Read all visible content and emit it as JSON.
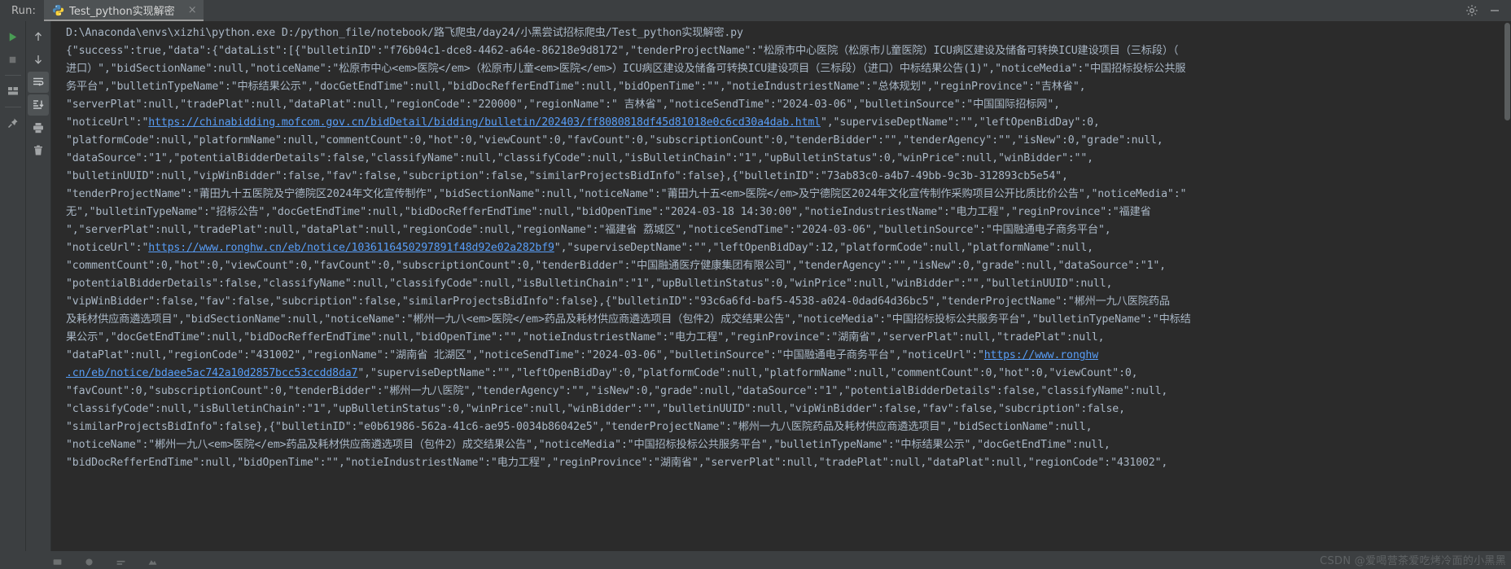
{
  "window": {
    "run_label": "Run:",
    "tab_title": "Test_python实现解密",
    "tab_close_glyph": "×"
  },
  "titlebar_actions": [
    {
      "name": "settings-icon",
      "label": "Settings"
    },
    {
      "name": "hide-icon",
      "label": "Hide"
    }
  ],
  "toolbar_primary": [
    {
      "name": "rerun-button",
      "label": "Rerun"
    },
    {
      "name": "stop-button",
      "label": "Stop"
    },
    {
      "name": "layout-button",
      "label": "Layout Settings"
    },
    {
      "name": "pin-button",
      "label": "Pin Tab"
    }
  ],
  "toolbar_secondary": [
    {
      "name": "up-stack-trace-button",
      "label": "Up the Stack Trace"
    },
    {
      "name": "down-stack-trace-button",
      "label": "Down the Stack Trace"
    },
    {
      "name": "soft-wrap-button",
      "label": "Soft-Wrap"
    },
    {
      "name": "scroll-to-end-button",
      "label": "Scroll to the End"
    },
    {
      "name": "print-button",
      "label": "Print"
    },
    {
      "name": "clear-all-button",
      "label": "Clear All"
    }
  ],
  "console": {
    "command": "D:\\Anaconda\\envs\\xizhi\\python.exe D:/python_file/notebook/路飞爬虫/day24/小黑尝试招标爬虫/Test_python实现解密.py",
    "lines": [
      [
        {
          "t": "{\"success\":true,\"data\":{\"dataList\":[{\"bulletinID\":\"f76b04c1-dce8-4462-a64e-86218e9d8172\",\"tenderProjectName\":\"松原市中心医院（松原市儿童医院）ICU病区建设及储备可转换ICU建设项目（三标段）（"
        }
      ],
      [
        {
          "t": "进口）\",\"bidSectionName\":null,\"noticeName\":\"松原市中心<em>医院</em>（松原市儿童<em>医院</em>）ICU病区建设及储备可转换ICU建设项目（三标段）（进口）中标结果公告(1)\",\"noticeMedia\":\"中国招标投标公共服"
        }
      ],
      [
        {
          "t": "务平台\",\"bulletinTypeName\":\"中标结果公示\",\"docGetEndTime\":null,\"bidDocRefferEndTime\":null,\"bidOpenTime\":\"\",\"notieIndustriestName\":\"总体规划\",\"reginProvince\":\"吉林省\","
        }
      ],
      [
        {
          "t": "\"serverPlat\":null,\"tradePlat\":null,\"dataPlat\":null,\"regionCode\":\"220000\",\"regionName\":\" 吉林省\",\"noticeSendTime\":\"2024-03-06\",\"bulletinSource\":\"中国国际招标网\","
        }
      ],
      [
        {
          "t": "\"noticeUrl\":\""
        },
        {
          "t": "https://chinabidding.mofcom.gov.cn/bidDetail/bidding/bulletin/202403/ff8080818df45d81018e0c6cd30a4dab.html",
          "link": true
        },
        {
          "t": "\",\"superviseDeptName\":\"\",\"leftOpenBidDay\":0,"
        }
      ],
      [
        {
          "t": "\"platformCode\":null,\"platformName\":null,\"commentCount\":0,\"hot\":0,\"viewCount\":0,\"favCount\":0,\"subscriptionCount\":0,\"tenderBidder\":\"\",\"tenderAgency\":\"\",\"isNew\":0,\"grade\":null,"
        }
      ],
      [
        {
          "t": "\"dataSource\":\"1\",\"potentialBidderDetails\":false,\"classifyName\":null,\"classifyCode\":null,\"isBulletinChain\":\"1\",\"upBulletinStatus\":0,\"winPrice\":null,\"winBidder\":\"\","
        }
      ],
      [
        {
          "t": "\"bulletinUUID\":null,\"vipWinBidder\":false,\"fav\":false,\"subcription\":false,\"similarProjectsBidInfo\":false},{\"bulletinID\":\"73ab83c0-a4b7-49bb-9c3b-312893cb5e54\","
        }
      ],
      [
        {
          "t": "\"tenderProjectName\":\"莆田九十五医院及宁德院区2024年文化宣传制作\",\"bidSectionName\":null,\"noticeName\":\"莆田九十五<em>医院</em>及宁德院区2024年文化宣传制作采购项目公开比质比价公告\",\"noticeMedia\":\""
        }
      ],
      [
        {
          "t": "无\",\"bulletinTypeName\":\"招标公告\",\"docGetEndTime\":null,\"bidDocRefferEndTime\":null,\"bidOpenTime\":\"2024-03-18 14:30:00\",\"notieIndustriestName\":\"电力工程\",\"reginProvince\":\"福建省"
        }
      ],
      [
        {
          "t": "\",\"serverPlat\":null,\"tradePlat\":null,\"dataPlat\":null,\"regionCode\":null,\"regionName\":\"福建省 荔城区\",\"noticeSendTime\":\"2024-03-06\",\"bulletinSource\":\"中国融通电子商务平台\","
        }
      ],
      [
        {
          "t": "\"noticeUrl\":\""
        },
        {
          "t": "https://www.ronghw.cn/eb/notice/1036116450297891f48d92e02a282bf9",
          "link": true
        },
        {
          "t": "\",\"superviseDeptName\":\"\",\"leftOpenBidDay\":12,\"platformCode\":null,\"platformName\":null,"
        }
      ],
      [
        {
          "t": "\"commentCount\":0,\"hot\":0,\"viewCount\":0,\"favCount\":0,\"subscriptionCount\":0,\"tenderBidder\":\"中国融通医疗健康集团有限公司\",\"tenderAgency\":\"\",\"isNew\":0,\"grade\":null,\"dataSource\":\"1\","
        }
      ],
      [
        {
          "t": "\"potentialBidderDetails\":false,\"classifyName\":null,\"classifyCode\":null,\"isBulletinChain\":\"1\",\"upBulletinStatus\":0,\"winPrice\":null,\"winBidder\":\"\",\"bulletinUUID\":null,"
        }
      ],
      [
        {
          "t": "\"vipWinBidder\":false,\"fav\":false,\"subcription\":false,\"similarProjectsBidInfo\":false},{\"bulletinID\":\"93c6a6fd-baf5-4538-a024-0dad64d36bc5\",\"tenderProjectName\":\"郴州一九八医院药品"
        }
      ],
      [
        {
          "t": "及耗材供应商遴选项目\",\"bidSectionName\":null,\"noticeName\":\"郴州一九八<em>医院</em>药品及耗材供应商遴选项目（包件2）成交结果公告\",\"noticeMedia\":\"中国招标投标公共服务平台\",\"bulletinTypeName\":\"中标结"
        }
      ],
      [
        {
          "t": "果公示\",\"docGetEndTime\":null,\"bidDocRefferEndTime\":null,\"bidOpenTime\":\"\",\"notieIndustriestName\":\"电力工程\",\"reginProvince\":\"湖南省\",\"serverPlat\":null,\"tradePlat\":null,"
        }
      ],
      [
        {
          "t": "\"dataPlat\":null,\"regionCode\":\"431002\",\"regionName\":\"湖南省 北湖区\",\"noticeSendTime\":\"2024-03-06\",\"bulletinSource\":\"中国融通电子商务平台\",\"noticeUrl\":\""
        },
        {
          "t": "https://www.ronghw",
          "link": true
        }
      ],
      [
        {
          "t": ".cn/eb/notice/bdaee5ac742a10d2857bcc53ccdd8da7",
          "link": true
        },
        {
          "t": "\",\"superviseDeptName\":\"\",\"leftOpenBidDay\":0,\"platformCode\":null,\"platformName\":null,\"commentCount\":0,\"hot\":0,\"viewCount\":0,"
        }
      ],
      [
        {
          "t": "\"favCount\":0,\"subscriptionCount\":0,\"tenderBidder\":\"郴州一九八医院\",\"tenderAgency\":\"\",\"isNew\":0,\"grade\":null,\"dataSource\":\"1\",\"potentialBidderDetails\":false,\"classifyName\":null,"
        }
      ],
      [
        {
          "t": "\"classifyCode\":null,\"isBulletinChain\":\"1\",\"upBulletinStatus\":0,\"winPrice\":null,\"winBidder\":\"\",\"bulletinUUID\":null,\"vipWinBidder\":false,\"fav\":false,\"subcription\":false,"
        }
      ],
      [
        {
          "t": "\"similarProjectsBidInfo\":false},{\"bulletinID\":\"e0b61986-562a-41c6-ae95-0034b86042e5\",\"tenderProjectName\":\"郴州一九八医院药品及耗材供应商遴选项目\",\"bidSectionName\":null,"
        }
      ],
      [
        {
          "t": "\"noticeName\":\"郴州一九八<em>医院</em>药品及耗材供应商遴选项目（包件2）成交结果公告\",\"noticeMedia\":\"中国招标投标公共服务平台\",\"bulletinTypeName\":\"中标结果公示\",\"docGetEndTime\":null,"
        }
      ],
      [
        {
          "t": "\"bidDocRefferEndTime\":null,\"bidOpenTime\":\"\",\"notieIndustriestName\":\"电力工程\",\"reginProvince\":\"湖南省\",\"serverPlat\":null,\"tradePlat\":null,\"dataPlat\":null,\"regionCode\":\"431002\","
        }
      ]
    ]
  },
  "watermark": "CSDN @爱喝营茶爱吃烤冷面的小黑黑",
  "colors": {
    "console_bg": "#2b2b2b",
    "panel_bg": "#3c3f41",
    "text": "#a9b7c6",
    "link": "#589df6",
    "run_green": "#499c54"
  }
}
